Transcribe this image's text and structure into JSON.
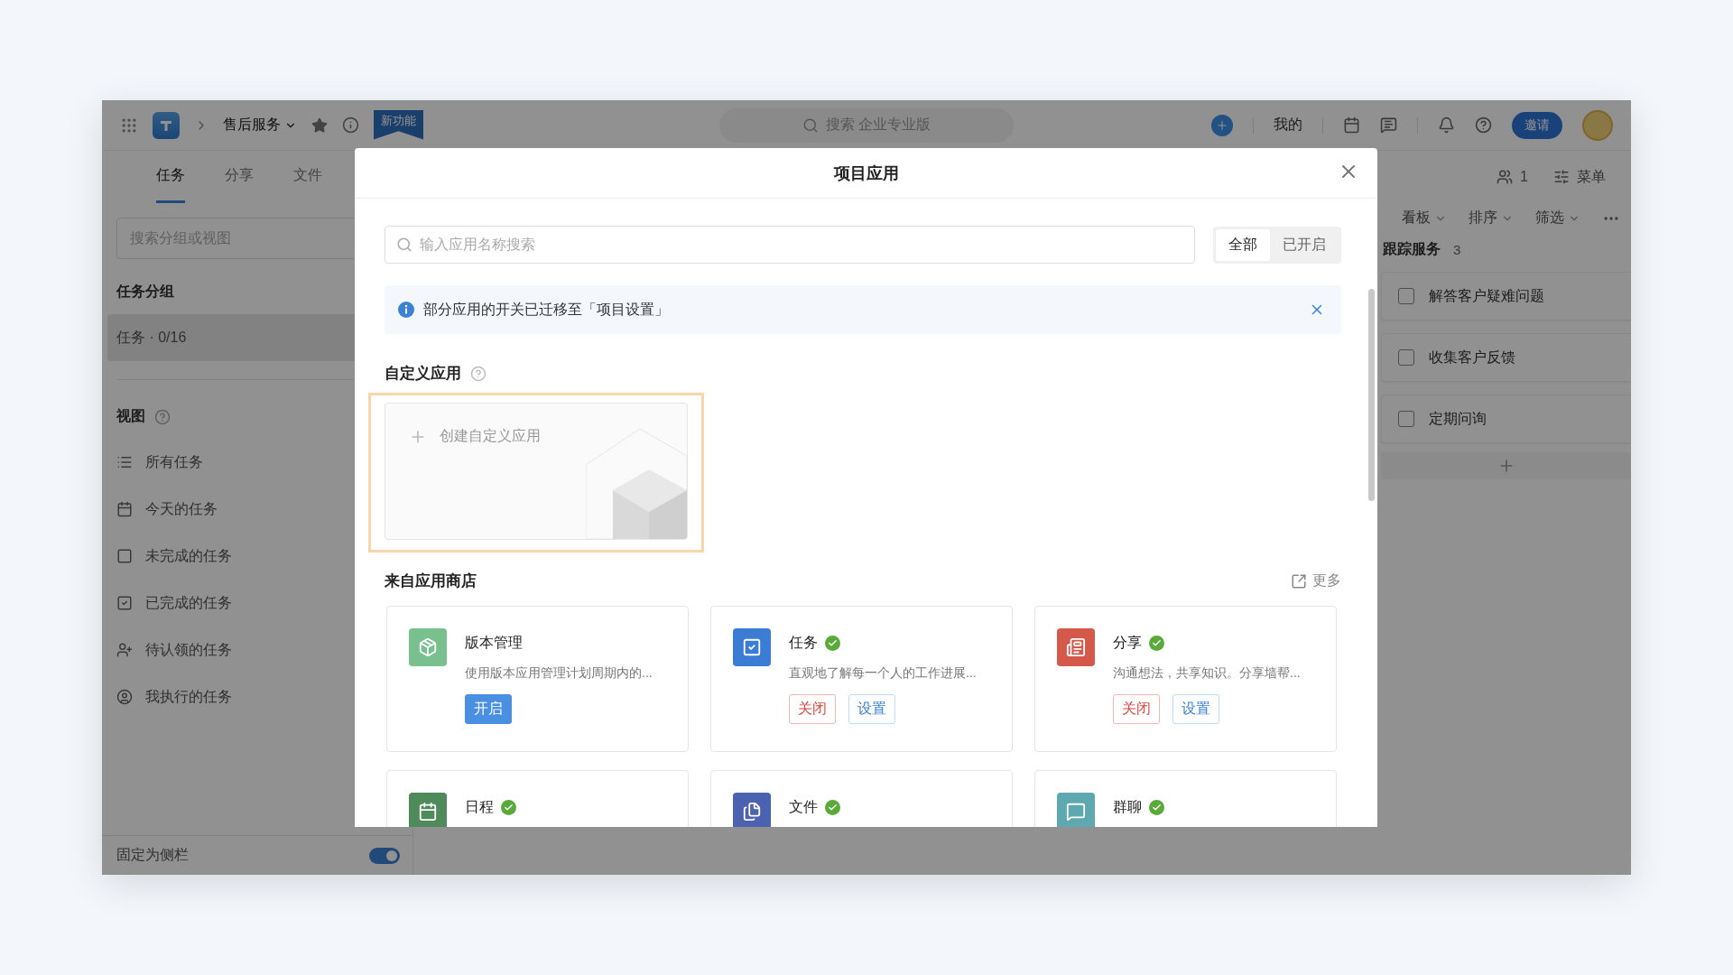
{
  "topbar": {
    "project": "售后服务",
    "badge": "新功能",
    "search_placeholder": "搜索 企业专业版",
    "mine": "我的",
    "invite": "邀请"
  },
  "tabs": [
    {
      "label": "任务",
      "selected": true
    },
    {
      "label": "分享",
      "selected": false
    },
    {
      "label": "文件",
      "selected": false
    }
  ],
  "header_right": {
    "members": "1",
    "menu": "菜单"
  },
  "sidebar": {
    "search_placeholder": "搜索分组或视图",
    "groups_title": "任务分组",
    "groups": [
      {
        "label": "任务 · 0/16",
        "selected": true
      }
    ],
    "views_title": "视图",
    "views": [
      {
        "kind": "list",
        "label": "所有任务"
      },
      {
        "kind": "calendar",
        "label": "今天的任务"
      },
      {
        "kind": "square",
        "label": "未完成的任务"
      },
      {
        "kind": "checked",
        "label": "已完成的任务"
      },
      {
        "kind": "claim",
        "label": "待认领的任务"
      },
      {
        "kind": "mine",
        "label": "我执行的任务"
      }
    ],
    "pin": {
      "label": "固定为侧栏",
      "on": true
    }
  },
  "board": {
    "options": [
      "看板",
      "排序",
      "筛选"
    ],
    "column": {
      "title": "跟踪服务",
      "count": "3",
      "tasks": [
        {
          "title": "解答客户疑难问题",
          "checked": false
        },
        {
          "title": "收集客户反馈",
          "checked": false
        },
        {
          "title": "定期问询",
          "checked": false
        }
      ]
    }
  },
  "modal": {
    "title": "项目应用",
    "search_placeholder": "输入应用名称搜索",
    "filters": [
      {
        "label": "全部",
        "selected": true
      },
      {
        "label": "已开启",
        "selected": false
      }
    ],
    "notice": "部分应用的开关已迁移至「项目设置」",
    "custom_title": "自定义应用",
    "create_label": "创建自定义应用",
    "store_title": "来自应用商店",
    "more": "更多",
    "apps": [
      {
        "name": "版本管理",
        "kind": "version",
        "color": "#78c08e",
        "enabled": false,
        "description": "使用版本应用管理计划周期内的...",
        "actions": [
          {
            "label": "开启",
            "kind": "primary"
          }
        ]
      },
      {
        "name": "任务",
        "kind": "task",
        "color": "#3b7dd4",
        "enabled": true,
        "description": "直观地了解每一个人的工作进展...",
        "actions": [
          {
            "label": "关闭",
            "kind": "danger"
          },
          {
            "label": "设置",
            "kind": "default"
          }
        ]
      },
      {
        "name": "分享",
        "kind": "share",
        "color": "#d4594b",
        "enabled": true,
        "description": "沟通想法，共享知识。分享墙帮...",
        "actions": [
          {
            "label": "关闭",
            "kind": "danger"
          },
          {
            "label": "设置",
            "kind": "default"
          }
        ]
      },
      {
        "name": "日程",
        "kind": "calendar",
        "color": "#4e8a5a",
        "enabled": true
      },
      {
        "name": "文件",
        "kind": "file",
        "color": "#4a62b0",
        "enabled": true
      },
      {
        "name": "群聊",
        "kind": "chat",
        "color": "#5ea8b0",
        "enabled": true
      }
    ]
  }
}
